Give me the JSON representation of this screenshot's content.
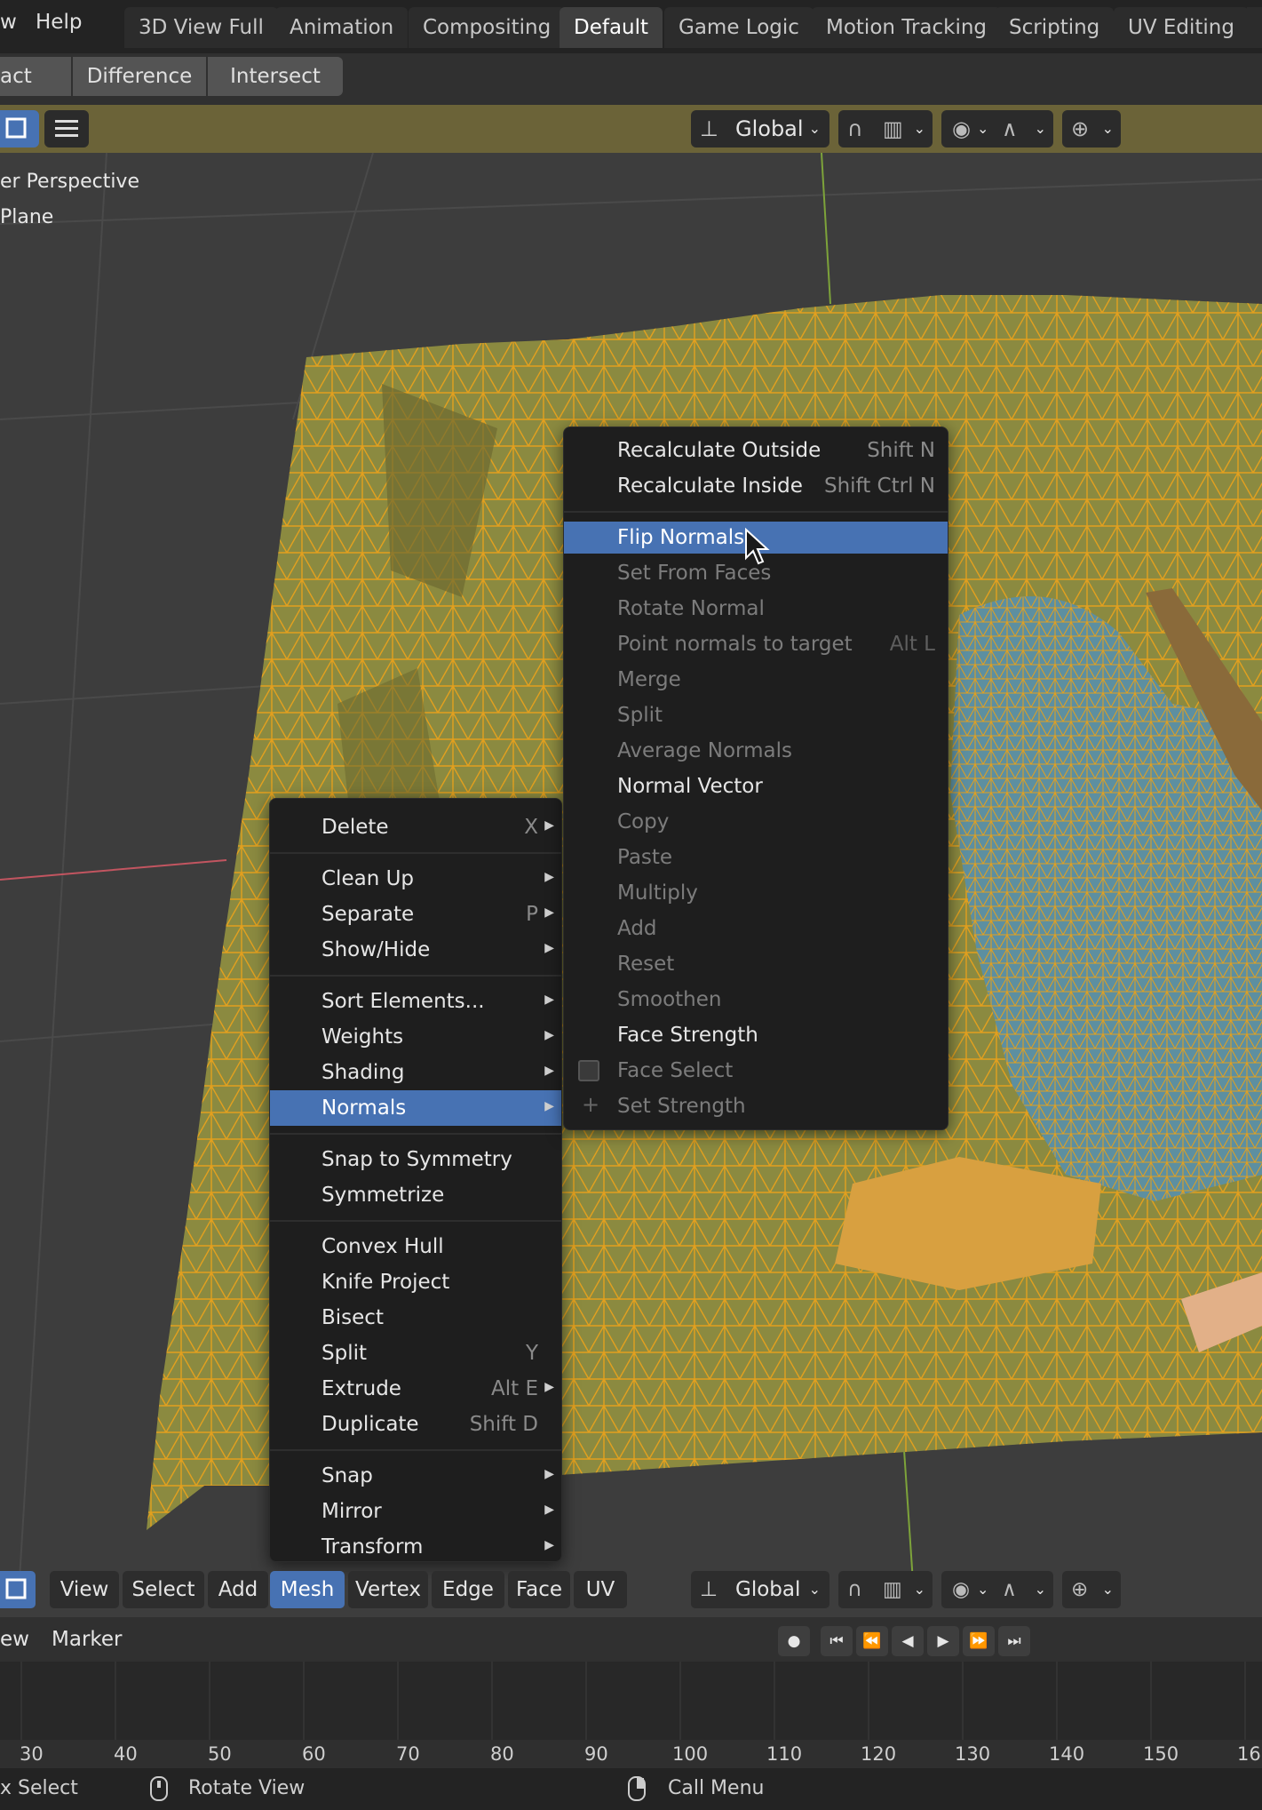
{
  "topbar": {
    "menu_view_partial": "w",
    "menu_help": "Help",
    "workspace_tabs": [
      "3D View Full",
      "Animation",
      "Compositing",
      "Default",
      "Game Logic",
      "Motion Tracking",
      "Scripting",
      "UV Editing"
    ],
    "active_tab": "Default"
  },
  "boolean_row": {
    "subtract_partial": "act",
    "difference": "Difference",
    "intersect": "Intersect"
  },
  "viewport_header": {
    "transform_orientation": "Global"
  },
  "viewport": {
    "view_name_partial": "er Perspective",
    "object_name_partial": "Plane"
  },
  "mesh_menu": {
    "items": [
      {
        "label": "Delete",
        "shortcut": "X",
        "submenu": true
      },
      {
        "label": "Clean Up",
        "shortcut": "",
        "submenu": true
      },
      {
        "label": "Separate",
        "shortcut": "P",
        "submenu": true
      },
      {
        "label": "Show/Hide",
        "shortcut": "",
        "submenu": true
      },
      {
        "label": "Sort Elements...",
        "shortcut": "",
        "submenu": true
      },
      {
        "label": "Weights",
        "shortcut": "",
        "submenu": true
      },
      {
        "label": "Shading",
        "shortcut": "",
        "submenu": true
      },
      {
        "label": "Normals",
        "shortcut": "",
        "submenu": true,
        "highlighted": true
      },
      {
        "label": "Snap to Symmetry",
        "shortcut": "",
        "submenu": false
      },
      {
        "label": "Symmetrize",
        "shortcut": "",
        "submenu": false
      },
      {
        "label": "Convex Hull",
        "shortcut": "",
        "submenu": false
      },
      {
        "label": "Knife Project",
        "shortcut": "",
        "submenu": false
      },
      {
        "label": "Bisect",
        "shortcut": "",
        "submenu": false
      },
      {
        "label": "Split",
        "shortcut": "Y",
        "submenu": false
      },
      {
        "label": "Extrude",
        "shortcut": "Alt E",
        "submenu": true
      },
      {
        "label": "Duplicate",
        "shortcut": "Shift D",
        "submenu": false
      },
      {
        "label": "Snap",
        "shortcut": "",
        "submenu": true
      },
      {
        "label": "Mirror",
        "shortcut": "",
        "submenu": true
      },
      {
        "label": "Transform",
        "shortcut": "",
        "submenu": true
      }
    ]
  },
  "normals_menu": {
    "items": [
      {
        "label": "Recalculate Outside",
        "shortcut": "Shift N",
        "enabled": true
      },
      {
        "label": "Recalculate Inside",
        "shortcut": "Shift Ctrl N",
        "enabled": true
      },
      {
        "label": "Flip Normals",
        "shortcut": "",
        "enabled": true,
        "highlighted": true
      },
      {
        "label": "Set From Faces",
        "shortcut": "",
        "enabled": false
      },
      {
        "label": "Rotate Normal",
        "shortcut": "",
        "enabled": false
      },
      {
        "label": "Point normals to target",
        "shortcut": "Alt L",
        "enabled": false
      },
      {
        "label": "Merge",
        "shortcut": "",
        "enabled": false
      },
      {
        "label": "Split",
        "shortcut": "",
        "enabled": false
      },
      {
        "label": "Average Normals",
        "shortcut": "",
        "enabled": false
      },
      {
        "label": "Normal Vector",
        "shortcut": "",
        "enabled": true
      },
      {
        "label": "Copy",
        "shortcut": "",
        "enabled": false
      },
      {
        "label": "Paste",
        "shortcut": "",
        "enabled": false
      },
      {
        "label": "Multiply",
        "shortcut": "",
        "enabled": false
      },
      {
        "label": "Add",
        "shortcut": "",
        "enabled": false
      },
      {
        "label": "Reset",
        "shortcut": "",
        "enabled": false
      },
      {
        "label": "Smoothen",
        "shortcut": "",
        "enabled": false
      },
      {
        "label": "Face Strength",
        "shortcut": "",
        "enabled": true
      },
      {
        "label": "Face Select",
        "shortcut": "",
        "enabled": false
      },
      {
        "label": "Set Strength",
        "shortcut": "",
        "enabled": false
      }
    ]
  },
  "bottom_header": {
    "buttons": [
      "View",
      "Select",
      "Add",
      "Mesh",
      "Vertex",
      "Edge",
      "Face",
      "UV"
    ],
    "active": "Mesh",
    "transform_orientation": "Global"
  },
  "timeline": {
    "view_partial": "ew",
    "marker": "Marker",
    "ticks": [
      "30",
      "40",
      "50",
      "60",
      "70",
      "80",
      "90",
      "100",
      "110",
      "120",
      "130",
      "140",
      "150",
      "16"
    ]
  },
  "statusbar": {
    "select_partial": "x Select",
    "rotate_view": "Rotate View",
    "call_menu": "Call Menu"
  },
  "colors": {
    "accent": "#4772b3",
    "mesh_yellow": "#8a8a3c",
    "mesh_wire": "#e8a020",
    "mesh_blue": "#5d8fa0"
  }
}
